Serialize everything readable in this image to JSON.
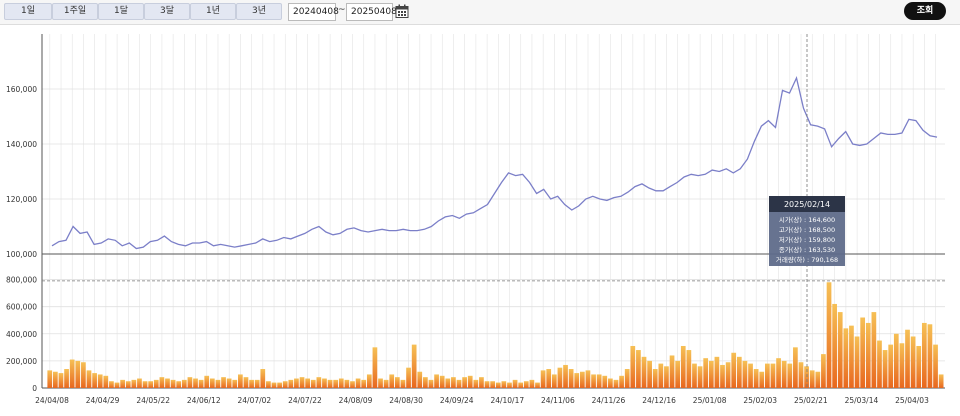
{
  "toolbar": {
    "periods": [
      "1일",
      "1주일",
      "1달",
      "3달",
      "1년",
      "3년"
    ],
    "start_date": "20240408",
    "separator": "~",
    "end_date": "20250408",
    "calendar_icon": "calendar-icon",
    "search_label": "조회"
  },
  "chart_data": [
    {
      "type": "line",
      "x_range": [
        "24/04/08",
        "25/04/08"
      ],
      "ylim": [
        100000,
        180000
      ],
      "y_ticks": [
        100000,
        120000,
        140000,
        160000
      ],
      "y_tick_labels": [
        "100,000",
        "120,000",
        "140,000",
        "160,000"
      ],
      "grid": true,
      "line_color": "#7b7fc8",
      "series": [
        {
          "values": [
            103000,
            104500,
            105000,
            110000,
            107500,
            108000,
            103500,
            104000,
            105500,
            105000,
            103000,
            104000,
            102000,
            102500,
            104500,
            105000,
            106500,
            104500,
            103500,
            103000,
            104000,
            104000,
            104500,
            103000,
            103500,
            103000,
            102500,
            103000,
            103500,
            104000,
            105500,
            104500,
            105000,
            106000,
            105500,
            106500,
            107500,
            109000,
            110000,
            108000,
            107000,
            107500,
            109000,
            109500,
            108500,
            108000,
            108500,
            109000,
            108500,
            108500,
            109000,
            108500,
            108500,
            109000,
            110000,
            112000,
            113500,
            114000,
            113000,
            114500,
            115000,
            116500,
            118000,
            122000,
            126000,
            129500,
            128500,
            129000,
            126000,
            122000,
            123500,
            120000,
            121000,
            118000,
            116000,
            117500,
            120000,
            121000,
            120000,
            119500,
            120500,
            121000,
            122500,
            124500,
            125500,
            124000,
            123000,
            123000,
            124500,
            126000,
            128000,
            129000,
            128500,
            129000,
            130500,
            130000,
            131000,
            129500,
            131000,
            134500,
            141000,
            146500,
            148500,
            146000,
            159500,
            158500,
            164000,
            153000,
            147000,
            146500,
            145500,
            139000,
            142000,
            144500,
            140000,
            139500,
            140000,
            142000,
            144000,
            143500,
            143500,
            144000,
            149000,
            148500,
            145000,
            143000,
            142500
          ]
        }
      ]
    },
    {
      "type": "bar",
      "x_range": [
        "24/04/08",
        "25/04/08"
      ],
      "ylim": [
        0,
        900000
      ],
      "y_ticks": [
        0,
        200000,
        400000,
        600000,
        800000
      ],
      "y_tick_labels": [
        "0",
        "200,000",
        "400,000",
        "600,000",
        "800,000"
      ],
      "x_tick_labels": [
        "24/04/08",
        "24/04/29",
        "24/05/22",
        "24/06/12",
        "24/07/02",
        "24/07/22",
        "24/08/09",
        "24/08/30",
        "24/09/24",
        "24/10/17",
        "24/11/06",
        "24/11/26",
        "24/12/16",
        "25/01/08",
        "25/02/03",
        "25/02/21",
        "25/03/14",
        "25/04/03"
      ],
      "grid": true,
      "bar_color_top": "#f6c055",
      "bar_color_bottom": "#e8671f",
      "series": [
        {
          "values": [
            130000,
            120000,
            110000,
            140000,
            210000,
            200000,
            190000,
            130000,
            110000,
            100000,
            90000,
            50000,
            40000,
            60000,
            50000,
            60000,
            70000,
            50000,
            50000,
            60000,
            80000,
            70000,
            60000,
            50000,
            60000,
            80000,
            70000,
            60000,
            90000,
            70000,
            60000,
            80000,
            70000,
            60000,
            100000,
            80000,
            60000,
            60000,
            140000,
            50000,
            40000,
            40000,
            50000,
            60000,
            70000,
            80000,
            70000,
            60000,
            80000,
            70000,
            60000,
            60000,
            70000,
            60000,
            50000,
            70000,
            60000,
            100000,
            300000,
            70000,
            60000,
            100000,
            80000,
            60000,
            150000,
            320000,
            120000,
            80000,
            60000,
            100000,
            90000,
            70000,
            80000,
            60000,
            80000,
            90000,
            60000,
            80000,
            50000,
            50000,
            40000,
            50000,
            40000,
            60000,
            40000,
            50000,
            60000,
            40000,
            130000,
            140000,
            100000,
            150000,
            170000,
            140000,
            110000,
            120000,
            130000,
            100000,
            100000,
            90000,
            70000,
            60000,
            90000,
            140000,
            310000,
            280000,
            230000,
            200000,
            140000,
            180000,
            160000,
            240000,
            200000,
            310000,
            280000,
            180000,
            160000,
            220000,
            200000,
            230000,
            170000,
            190000,
            260000,
            230000,
            200000,
            180000,
            140000,
            120000,
            180000,
            180000,
            220000,
            200000,
            180000,
            300000,
            190000,
            160000,
            130000,
            120000,
            250000,
            780000,
            620000,
            560000,
            440000,
            460000,
            380000,
            520000,
            480000,
            560000,
            350000,
            280000,
            320000,
            400000,
            330000,
            430000,
            380000,
            310000,
            480000,
            470000,
            320000,
            100000
          ]
        }
      ]
    }
  ],
  "tooltip": {
    "date": "2025/02/14",
    "lines": [
      "시가(상) : 164,600",
      "고가(상) : 168,500",
      "저가(상) : 159,800",
      "종가(상) : 163,530",
      "거래량(하) : 790,168"
    ]
  }
}
